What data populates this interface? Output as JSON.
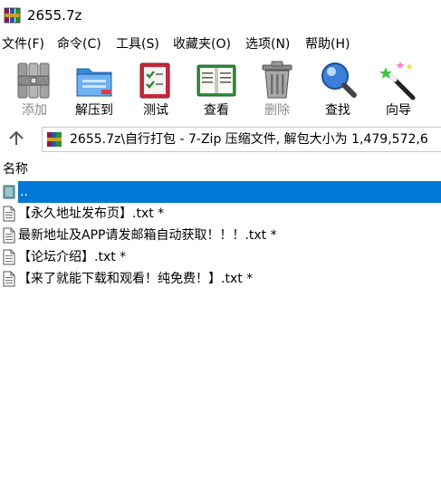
{
  "window": {
    "title": "2655.7z"
  },
  "menu": [
    {
      "label": "文件(F)"
    },
    {
      "label": "命令(C)"
    },
    {
      "label": "工具(S)"
    },
    {
      "label": "收藏夹(O)"
    },
    {
      "label": "选项(N)"
    },
    {
      "label": "帮助(H)"
    }
  ],
  "toolbar": {
    "buttons": [
      {
        "label": "添加",
        "icon": "books-stack-icon",
        "enabled": false
      },
      {
        "label": "解压到",
        "icon": "folder-extract-icon",
        "enabled": true
      },
      {
        "label": "测试",
        "icon": "checklist-icon",
        "enabled": true
      },
      {
        "label": "查看",
        "icon": "open-book-icon",
        "enabled": true
      },
      {
        "label": "删除",
        "icon": "trash-can-icon",
        "enabled": false
      },
      {
        "label": "查找",
        "icon": "magnifier-icon",
        "enabled": true
      },
      {
        "label": "向导",
        "icon": "magic-wand-icon",
        "enabled": true
      }
    ]
  },
  "address": {
    "path": "2655.7z\\自行打包 - 7-Zip 压缩文件, 解包大小为 1,479,572,6"
  },
  "list": {
    "columns": [
      {
        "label": "名称"
      }
    ],
    "rows": [
      {
        "name": "..",
        "type": "parent",
        "selected": true
      },
      {
        "name": "【永久地址发布页】.txt *",
        "type": "file",
        "selected": false
      },
      {
        "name": "最新地址及APP请发邮箱自动获取！！！.txt *",
        "type": "file",
        "selected": false
      },
      {
        "name": "【论坛介绍】.txt *",
        "type": "file",
        "selected": false
      },
      {
        "name": "【来了就能下载和观看！纯免费！】.txt *",
        "type": "file",
        "selected": false
      }
    ]
  },
  "colors": {
    "selection": "#0078d7",
    "disabled_text": "#8a8a8a"
  }
}
